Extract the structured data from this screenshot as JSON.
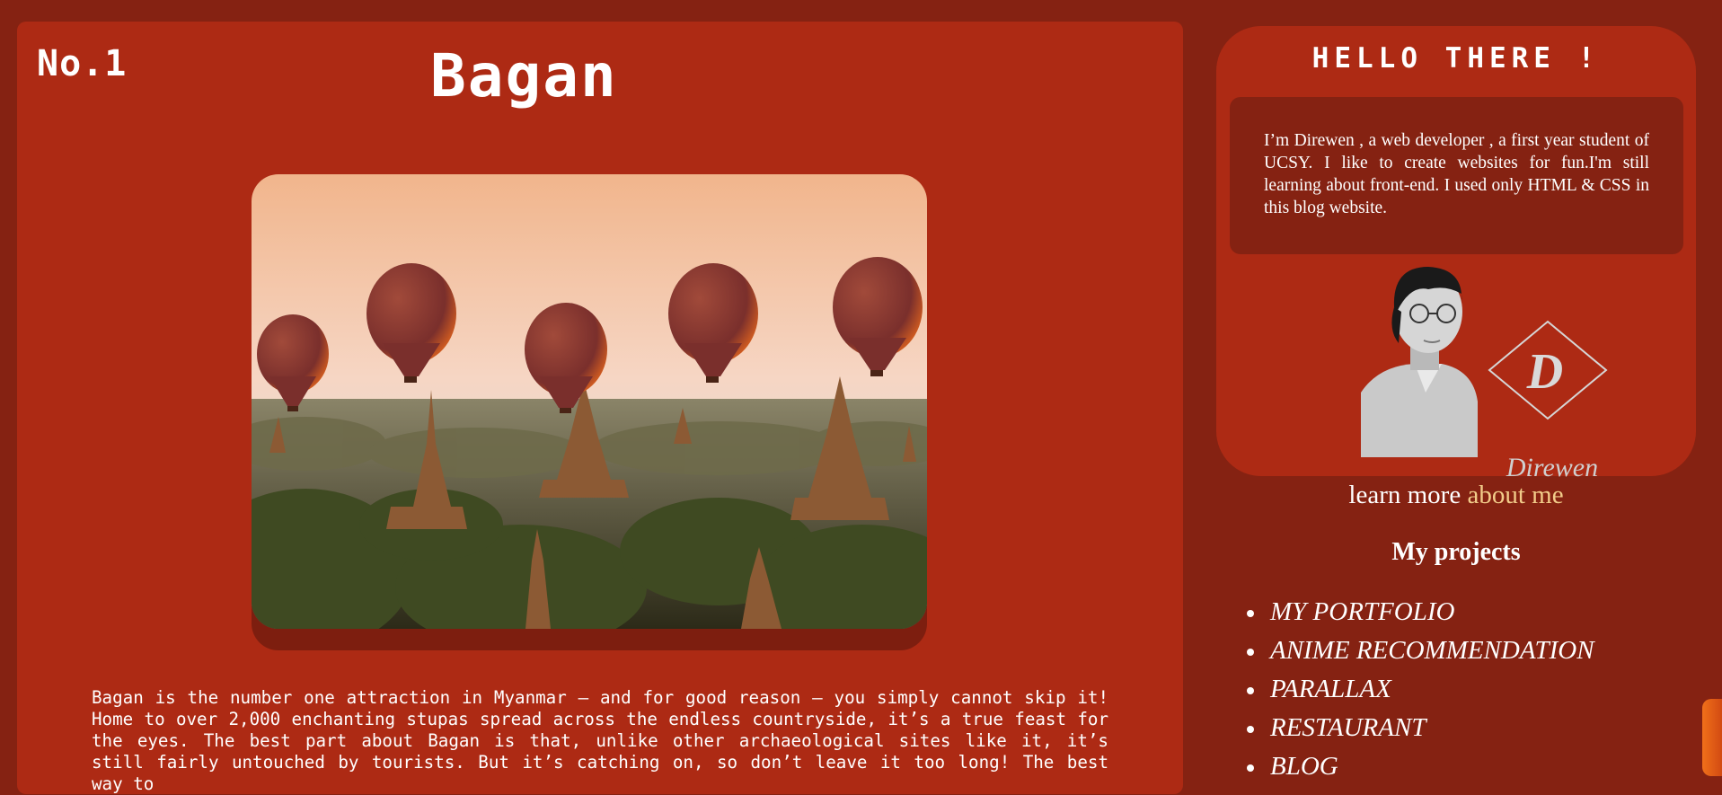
{
  "post": {
    "number": "No.1",
    "title": "Bagan",
    "image_alt": "hot-air-balloons-over-bagan-temples",
    "body": "Bagan is the number one attraction in Myanmar – and for good reason – you simply cannot skip it! Home to over 2,000 enchanting stupas spread across the endless countryside, it’s a true feast for the eyes. The best part about Bagan is that, unlike other archaeological sites like it, it’s still fairly untouched by tourists. But it’s catching on, so don’t leave it too long! The best way to"
  },
  "profile": {
    "greeting": "HELLO THERE !",
    "bio": "I’m Direwen , a web developer , a first year student of UCSY. I like to create websites for fun.I'm still learning about front-end. I used only HTML & CSS in this blog website.",
    "logo_text": "Direwen",
    "logo_letter": "D"
  },
  "learn_more": {
    "prefix": "learn more",
    "link": "about me"
  },
  "projects": {
    "title": "My projects",
    "items": [
      {
        "label": "MY PORTFOLIO"
      },
      {
        "label": "ANIME RECOMMENDATION"
      },
      {
        "label": "PARALLAX"
      },
      {
        "label": "RESTAURANT"
      },
      {
        "label": "BLOG"
      }
    ]
  },
  "colors": {
    "background": "#852212",
    "card": "#ad2a14",
    "link_accent": "#f2cc8a",
    "text": "#ffffff"
  }
}
